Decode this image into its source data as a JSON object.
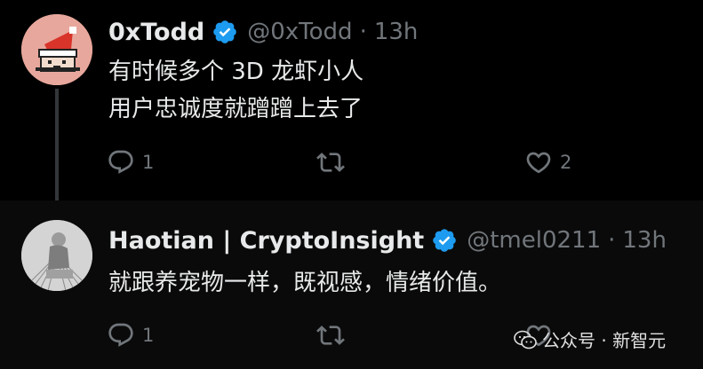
{
  "tweets": [
    {
      "display_name": "0xTodd",
      "handle": "@0xTodd",
      "separator": "·",
      "time": "13h",
      "lines": [
        "有时候多个 3D 龙虾小人",
        "用户忠诚度就蹭蹭上去了"
      ],
      "reply_count": "1",
      "like_count": "2"
    },
    {
      "display_name": "Haotian | CryptoInsight",
      "handle": "@tmel0211",
      "separator": "·",
      "time": "13h",
      "lines": [
        "就跟养宠物一样，既视感，情绪价值。"
      ],
      "reply_count": "1"
    }
  ],
  "watermark": {
    "text": "公众号 · 新智元"
  },
  "colors": {
    "background": "#000000",
    "text": "#e7e9ea",
    "muted": "#71767b",
    "verified": "#1d9bf0"
  },
  "icons": [
    "reply-icon",
    "retweet-icon",
    "like-icon",
    "verified-badge-icon",
    "wechat-icon"
  ]
}
